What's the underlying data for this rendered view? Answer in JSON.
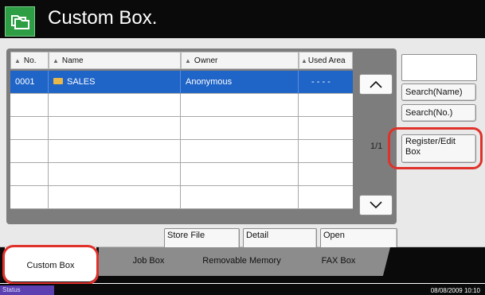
{
  "header": {
    "title": "Custom Box.",
    "app_icon": "copy-folder-icon"
  },
  "table": {
    "columns": [
      {
        "label": "No."
      },
      {
        "label": "Name"
      },
      {
        "label": "Owner"
      },
      {
        "label": "Used Area"
      }
    ],
    "rows": [
      {
        "no": "0001",
        "name": "SALES",
        "owner": "Anonymous",
        "used": "- - - -",
        "selected": true
      },
      {
        "no": "",
        "name": "",
        "owner": "",
        "used": ""
      },
      {
        "no": "",
        "name": "",
        "owner": "",
        "used": ""
      },
      {
        "no": "",
        "name": "",
        "owner": "",
        "used": ""
      },
      {
        "no": "",
        "name": "",
        "owner": "",
        "used": ""
      },
      {
        "no": "",
        "name": "",
        "owner": "",
        "used": ""
      }
    ],
    "page_indicator": "1/1"
  },
  "side": {
    "search_name": "Search(Name)",
    "search_no": "Search(No.)",
    "register_edit": "Register/Edit Box"
  },
  "actions": {
    "store_file": "Store File",
    "detail": "Detail",
    "open": "Open"
  },
  "tabs": {
    "custom_box": "Custom Box",
    "job_box": "Job Box",
    "removable_memory": "Removable Memory",
    "fax_box": "FAX Box"
  },
  "status": {
    "label": "Status",
    "datetime": "08/08/2009   10:10"
  },
  "colors": {
    "accent_green": "#2e9e45",
    "selection_blue": "#1f64c7",
    "highlight_red": "#e0312b",
    "status_purple": "#5c3fb0"
  }
}
